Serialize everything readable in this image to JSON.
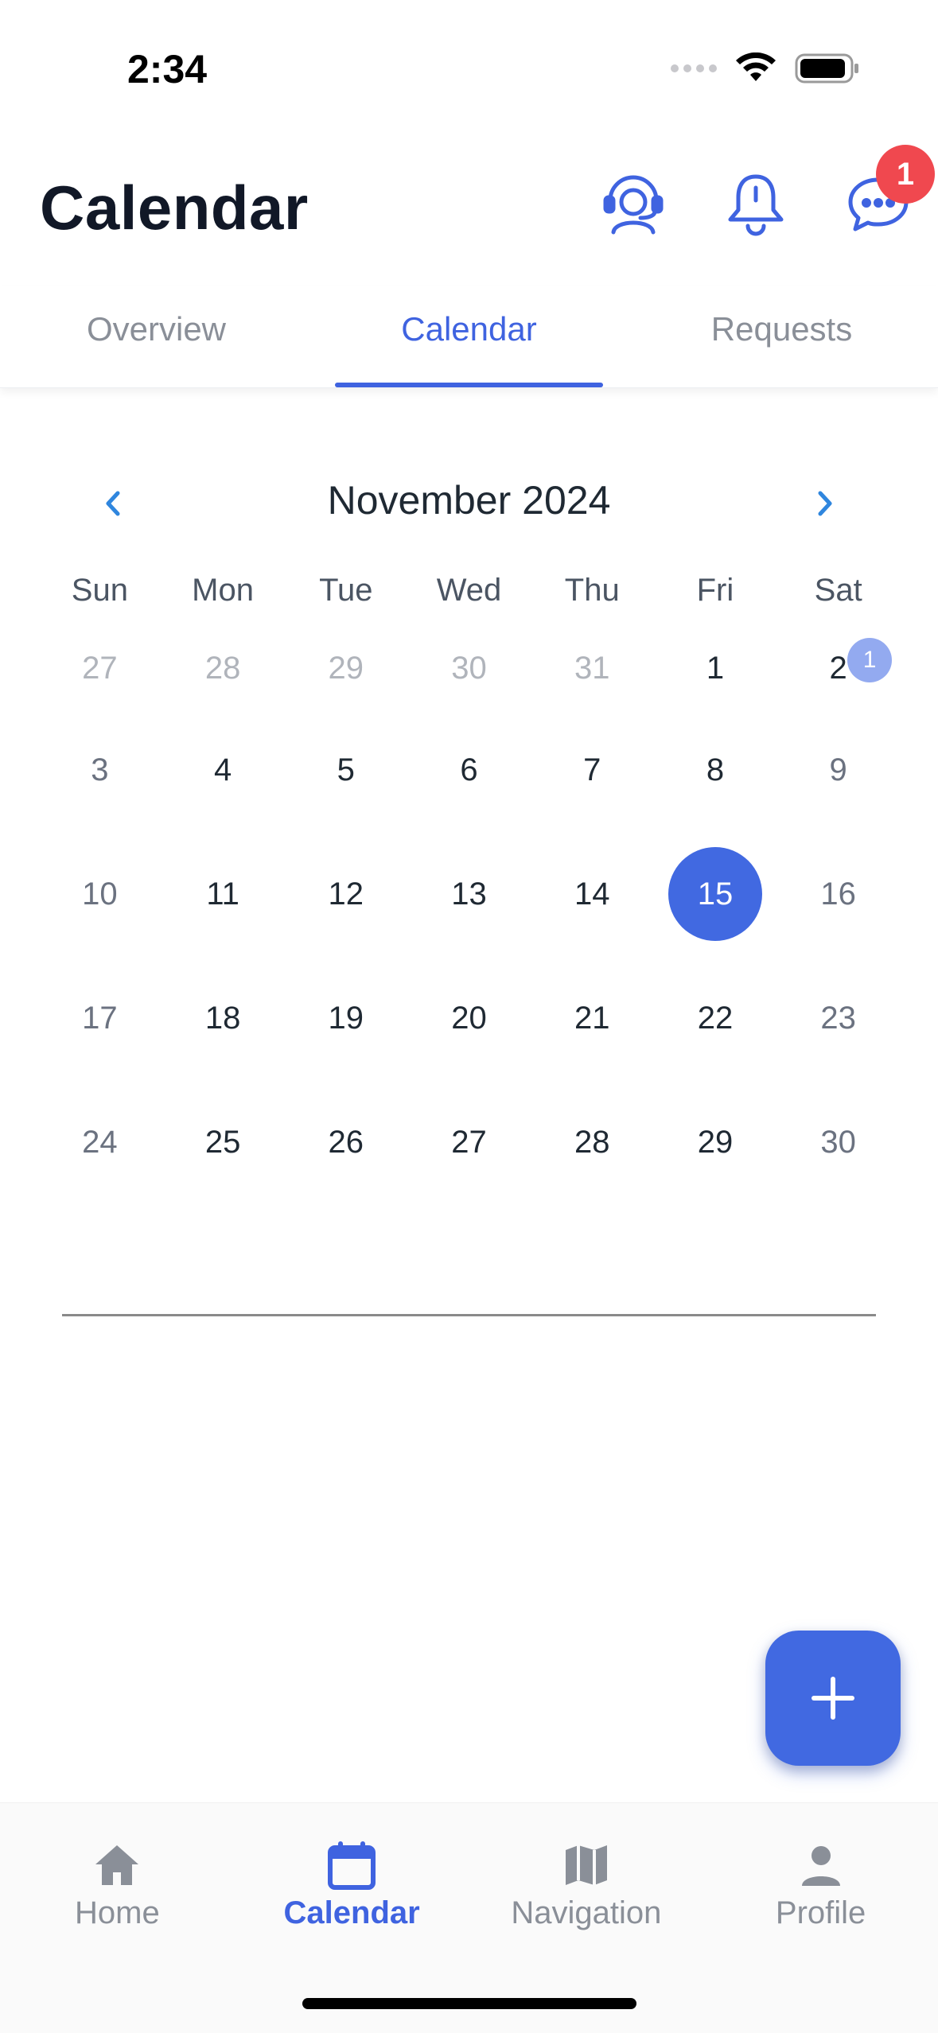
{
  "status_bar": {
    "time": "2:34"
  },
  "header": {
    "title": "Calendar",
    "icons": [
      "support-agent-icon",
      "bell-icon",
      "chat-icon"
    ],
    "chat_badge": "1"
  },
  "tabs": [
    {
      "label": "Overview",
      "active": false
    },
    {
      "label": "Calendar",
      "active": true
    },
    {
      "label": "Requests",
      "active": false
    }
  ],
  "calendar": {
    "month_label": "November 2024",
    "weekdays": [
      "Sun",
      "Mon",
      "Tue",
      "Wed",
      "Thu",
      "Fri",
      "Sat"
    ],
    "weeks": [
      [
        "27",
        "28",
        "29",
        "30",
        "31",
        "1",
        "2"
      ],
      [
        "3",
        "4",
        "5",
        "6",
        "7",
        "8",
        "9"
      ],
      [
        "10",
        "11",
        "12",
        "13",
        "14",
        "15",
        "16"
      ],
      [
        "17",
        "18",
        "19",
        "20",
        "21",
        "22",
        "23"
      ],
      [
        "24",
        "25",
        "26",
        "27",
        "28",
        "29",
        "30"
      ]
    ],
    "selected_day": "15",
    "event_badge": {
      "day": "2",
      "count": "1"
    }
  },
  "bottom_nav": [
    {
      "label": "Home",
      "icon": "home-icon",
      "active": false
    },
    {
      "label": "Calendar",
      "icon": "calendar-icon",
      "active": true
    },
    {
      "label": "Navigation",
      "icon": "map-icon",
      "active": false
    },
    {
      "label": "Profile",
      "icon": "person-icon",
      "active": false
    }
  ],
  "colors": {
    "accent": "#4169e1",
    "badge_red": "#f0484f",
    "muted_text": "#8a8f98"
  }
}
